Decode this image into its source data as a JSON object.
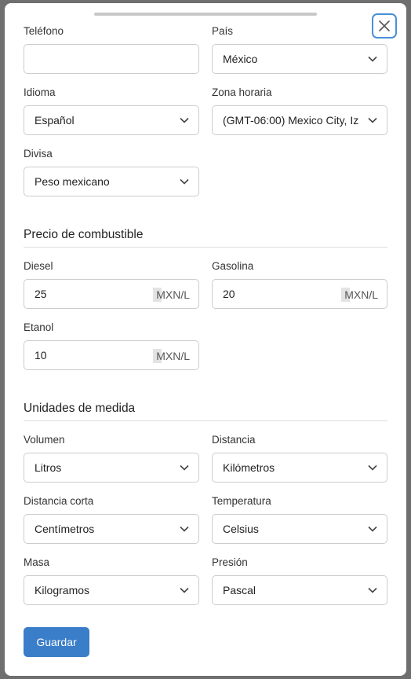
{
  "modal": {
    "phone": {
      "label": "Teléfono",
      "value": ""
    },
    "country": {
      "label": "País",
      "value": "México"
    },
    "language": {
      "label": "Idioma",
      "value": "Español"
    },
    "timezone": {
      "label": "Zona horaria",
      "value": "(GMT-06:00) Mexico City, Iz"
    },
    "currency": {
      "label": "Divisa",
      "value": "Peso mexicano"
    }
  },
  "fuel": {
    "title": "Precio de combustible",
    "diesel": {
      "label": "Diesel",
      "value": "25",
      "unit": "MXN/L"
    },
    "gasoline": {
      "label": "Gasolina",
      "value": "20",
      "unit": "MXN/L"
    },
    "ethanol": {
      "label": "Etanol",
      "value": "10",
      "unit": "MXN/L"
    }
  },
  "units": {
    "title": "Unidades de medida",
    "volume": {
      "label": "Volumen",
      "value": "Litros"
    },
    "distance": {
      "label": "Distancia",
      "value": "Kilómetros"
    },
    "short_distance": {
      "label": "Distancia corta",
      "value": "Centímetros"
    },
    "temperature": {
      "label": "Temperatura",
      "value": "Celsius"
    },
    "mass": {
      "label": "Masa",
      "value": "Kilogramos"
    },
    "pressure": {
      "label": "Presión",
      "value": "Pascal"
    }
  },
  "actions": {
    "save_label": "Guardar"
  },
  "colors": {
    "accent": "#3a7dc9",
    "close_border": "#4a90d9",
    "overlay": "#6f6f6f"
  },
  "icons": {
    "close": "close-icon",
    "select": "chevron-down-icon"
  }
}
